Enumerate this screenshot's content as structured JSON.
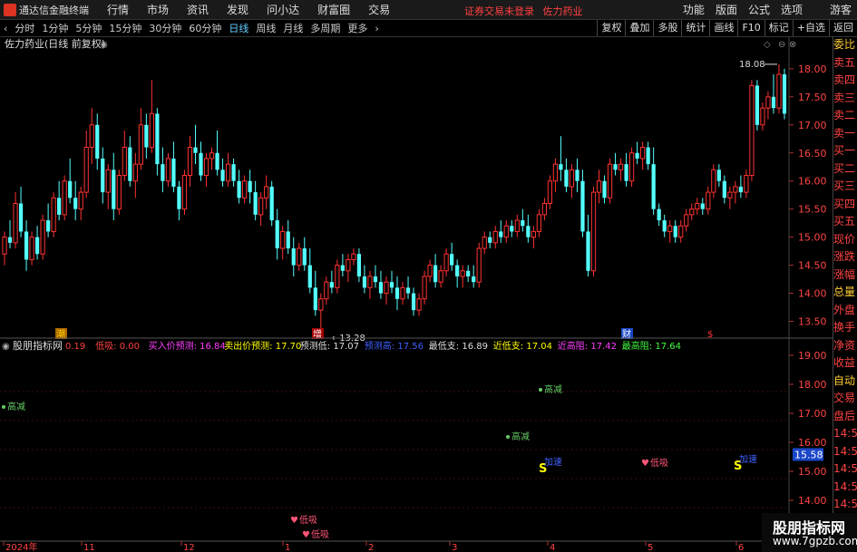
{
  "app": {
    "title": "通达信金融终端"
  },
  "menu": [
    "行情",
    "市场",
    "资讯",
    "发现",
    "问小达",
    "财富圈",
    "交易"
  ],
  "login_warning": "证券交易未登录",
  "stock_name": "佐力药业",
  "menu_right": [
    "功能",
    "版面",
    "公式",
    "选项",
    "游客"
  ],
  "periods": [
    "分时",
    "1分钟",
    "5分钟",
    "15分钟",
    "30分钟",
    "60分钟",
    "日线",
    "周线",
    "月线",
    "多周期",
    "更多"
  ],
  "active_period": "日线",
  "toolbar_right": [
    "复权",
    "叠加",
    "多股",
    "统计",
    "画线",
    "F10",
    "标记",
    "+自选",
    "返回"
  ],
  "chart_title": "佐力药业(日线 前复权)",
  "side_panel": [
    {
      "t": "委比",
      "c": "yellow"
    },
    {
      "t": "卖五",
      "c": "red"
    },
    {
      "t": "卖四",
      "c": "red"
    },
    {
      "t": "卖三",
      "c": "red"
    },
    {
      "t": "卖二",
      "c": "red"
    },
    {
      "t": "卖一",
      "c": "red"
    },
    {
      "t": "买一",
      "c": "red"
    },
    {
      "t": "买二",
      "c": "red"
    },
    {
      "t": "买三",
      "c": "red"
    },
    {
      "t": "买四",
      "c": "red"
    },
    {
      "t": "买五",
      "c": "red"
    },
    {
      "t": "现价",
      "c": "red"
    },
    {
      "t": "涨跌",
      "c": "red"
    },
    {
      "t": "涨幅",
      "c": "red"
    },
    {
      "t": "总量",
      "c": "yellow"
    },
    {
      "t": "外盘",
      "c": "red"
    },
    {
      "t": "换手",
      "c": "red"
    },
    {
      "t": "净资",
      "c": "red"
    },
    {
      "t": "收益",
      "c": "red"
    },
    {
      "t": "自动",
      "c": "yellow"
    },
    {
      "t": "交易",
      "c": "red"
    },
    {
      "t": "盘后",
      "c": "red"
    },
    {
      "t": "14:56",
      "c": "red"
    },
    {
      "t": "14:56",
      "c": "red"
    },
    {
      "t": "14:56",
      "c": "red"
    },
    {
      "t": "14:56",
      "c": "red"
    },
    {
      "t": "14:56",
      "c": "red"
    },
    {
      "t": "14:56",
      "c": "red"
    },
    {
      "t": "14:56",
      "c": "red"
    }
  ],
  "price_axis": {
    "ticks": [
      18.0,
      17.5,
      17.0,
      16.5,
      16.0,
      15.5,
      15.0,
      14.5,
      14.0,
      13.5
    ],
    "top": 18.45,
    "bottom": 13.25
  },
  "main_annotations": {
    "high": "18.08",
    "low": "13.28",
    "markers": [
      "潮",
      "增",
      "财",
      "$"
    ]
  },
  "indicator": {
    "name": "股朋指标网",
    "values": [
      {
        "label": "",
        "value": "0.19",
        "color": "#ff4040"
      },
      {
        "label": "低吸:",
        "value": "0.00",
        "color": "#ff4040"
      },
      {
        "label": "买入价预测:",
        "value": "16.84",
        "color": "#ff40ff"
      },
      {
        "label": "卖出价预测:",
        "value": "17.70",
        "color": "#ffff00"
      },
      {
        "label": "预测低:",
        "value": "17.07",
        "color": "#dddddd"
      },
      {
        "label": "预测高:",
        "value": "17.56",
        "color": "#4060ff"
      },
      {
        "label": "最低支:",
        "value": "16.89",
        "color": "#dddddd"
      },
      {
        "label": "近低支:",
        "value": "17.04",
        "color": "#ffff00"
      },
      {
        "label": "近高阻:",
        "value": "17.42",
        "color": "#ff40ff"
      },
      {
        "label": "最高阻:",
        "value": "17.64",
        "color": "#40ff40"
      }
    ],
    "axis_ticks": [
      19.0,
      18.0,
      17.0,
      16.0,
      15.0,
      14.0
    ],
    "current_price": "15.58",
    "annotations": {
      "reduce": "高减",
      "accelerate": "加速",
      "buy_low": "低吸",
      "sell": "S"
    }
  },
  "date_axis": [
    "2024年",
    "11",
    "12",
    "1",
    "2",
    "3",
    "4",
    "5",
    "6"
  ],
  "watermark": {
    "line1": "股朋指标网",
    "line2": "www.7gpzb.com"
  },
  "chart_data": {
    "type": "candlestick",
    "ylim": [
      13.25,
      18.45
    ],
    "candles": [
      [
        14.7,
        15.1,
        14.5,
        15.0
      ],
      [
        15.0,
        15.3,
        14.8,
        14.9
      ],
      [
        14.9,
        15.8,
        14.8,
        15.6
      ],
      [
        15.6,
        15.9,
        15.0,
        15.1
      ],
      [
        15.1,
        15.3,
        14.4,
        14.6
      ],
      [
        14.6,
        15.1,
        14.5,
        15.0
      ],
      [
        15.0,
        15.2,
        14.6,
        14.7
      ],
      [
        14.7,
        15.4,
        14.6,
        15.3
      ],
      [
        15.3,
        15.6,
        15.0,
        15.1
      ],
      [
        15.1,
        15.8,
        15.0,
        15.7
      ],
      [
        15.7,
        16.0,
        15.3,
        15.4
      ],
      [
        15.4,
        16.1,
        15.3,
        16.0
      ],
      [
        16.0,
        16.4,
        15.6,
        15.7
      ],
      [
        15.7,
        16.0,
        15.3,
        15.5
      ],
      [
        15.5,
        15.9,
        15.3,
        15.8
      ],
      [
        15.8,
        16.9,
        15.7,
        16.6
      ],
      [
        16.6,
        17.3,
        16.3,
        17.0
      ],
      [
        17.0,
        17.2,
        16.2,
        16.4
      ],
      [
        16.4,
        16.6,
        15.6,
        15.8
      ],
      [
        15.8,
        16.3,
        15.5,
        16.2
      ],
      [
        16.2,
        16.5,
        15.3,
        15.5
      ],
      [
        15.5,
        16.2,
        15.4,
        16.1
      ],
      [
        16.1,
        16.9,
        16.0,
        16.6
      ],
      [
        16.6,
        16.8,
        15.9,
        16.0
      ],
      [
        16.0,
        16.5,
        15.7,
        16.3
      ],
      [
        16.3,
        17.3,
        16.2,
        17.0
      ],
      [
        17.0,
        17.2,
        16.4,
        16.6
      ],
      [
        16.6,
        17.8,
        16.5,
        17.2
      ],
      [
        17.2,
        17.3,
        16.1,
        16.3
      ],
      [
        16.3,
        16.6,
        15.8,
        16.0
      ],
      [
        16.0,
        16.5,
        15.9,
        16.4
      ],
      [
        16.4,
        16.7,
        15.8,
        15.9
      ],
      [
        15.9,
        16.0,
        15.3,
        15.5
      ],
      [
        15.5,
        16.2,
        15.4,
        16.1
      ],
      [
        16.1,
        16.8,
        15.9,
        16.6
      ],
      [
        16.6,
        17.0,
        16.3,
        16.5
      ],
      [
        16.5,
        16.7,
        16.0,
        16.1
      ],
      [
        16.1,
        16.5,
        15.9,
        16.4
      ],
      [
        16.4,
        16.6,
        16.2,
        16.5
      ],
      [
        16.5,
        16.9,
        16.1,
        16.2
      ],
      [
        16.2,
        16.4,
        15.9,
        16.0
      ],
      [
        16.0,
        16.5,
        15.9,
        16.3
      ],
      [
        16.3,
        16.4,
        15.9,
        16.0
      ],
      [
        16.0,
        16.2,
        15.6,
        15.7
      ],
      [
        15.7,
        16.1,
        15.6,
        16.0
      ],
      [
        16.0,
        16.2,
        15.6,
        15.8
      ],
      [
        15.8,
        16.0,
        15.3,
        15.4
      ],
      [
        15.4,
        15.8,
        15.2,
        15.7
      ],
      [
        15.7,
        16.1,
        15.5,
        15.9
      ],
      [
        15.9,
        16.0,
        15.2,
        15.3
      ],
      [
        15.3,
        15.5,
        14.6,
        14.8
      ],
      [
        14.8,
        15.2,
        14.6,
        15.1
      ],
      [
        15.1,
        15.3,
        14.7,
        14.8
      ],
      [
        14.8,
        15.0,
        14.3,
        14.5
      ],
      [
        14.5,
        14.9,
        14.4,
        14.8
      ],
      [
        14.8,
        15.0,
        14.4,
        14.5
      ],
      [
        14.5,
        14.8,
        14.0,
        14.1
      ],
      [
        14.1,
        14.4,
        13.6,
        13.7
      ],
      [
        13.7,
        14.0,
        13.28,
        13.9
      ],
      [
        13.9,
        14.3,
        13.8,
        14.2
      ],
      [
        14.2,
        14.4,
        14.0,
        14.1
      ],
      [
        14.1,
        14.6,
        14.0,
        14.5
      ],
      [
        14.5,
        14.7,
        14.3,
        14.4
      ],
      [
        14.4,
        14.7,
        14.2,
        14.6
      ],
      [
        14.6,
        14.8,
        14.5,
        14.7
      ],
      [
        14.7,
        14.8,
        14.2,
        14.3
      ],
      [
        14.3,
        14.5,
        14.0,
        14.1
      ],
      [
        14.1,
        14.4,
        13.9,
        14.3
      ],
      [
        14.3,
        14.5,
        14.1,
        14.2
      ],
      [
        14.2,
        14.4,
        13.9,
        14.0
      ],
      [
        14.0,
        14.3,
        13.8,
        14.2
      ],
      [
        14.2,
        14.4,
        14.0,
        14.1
      ],
      [
        14.1,
        14.3,
        13.7,
        13.9
      ],
      [
        13.9,
        14.2,
        13.8,
        14.1
      ],
      [
        14.1,
        14.3,
        13.9,
        14.0
      ],
      [
        14.0,
        14.1,
        13.6,
        13.7
      ],
      [
        13.7,
        14.0,
        13.6,
        13.9
      ],
      [
        13.9,
        14.4,
        13.8,
        14.3
      ],
      [
        14.3,
        14.6,
        14.2,
        14.5
      ],
      [
        14.5,
        14.7,
        14.1,
        14.2
      ],
      [
        14.2,
        14.5,
        14.1,
        14.4
      ],
      [
        14.4,
        14.8,
        14.3,
        14.7
      ],
      [
        14.7,
        14.9,
        14.4,
        14.5
      ],
      [
        14.5,
        14.6,
        14.1,
        14.3
      ],
      [
        14.3,
        14.5,
        14.1,
        14.4
      ],
      [
        14.4,
        14.5,
        14.2,
        14.3
      ],
      [
        14.3,
        14.5,
        14.1,
        14.2
      ],
      [
        14.2,
        14.9,
        14.1,
        14.8
      ],
      [
        14.8,
        15.1,
        14.7,
        15.0
      ],
      [
        15.0,
        15.1,
        14.8,
        14.9
      ],
      [
        14.9,
        15.2,
        14.8,
        15.1
      ],
      [
        15.1,
        15.3,
        14.9,
        15.0
      ],
      [
        15.0,
        15.3,
        14.9,
        15.2
      ],
      [
        15.2,
        15.3,
        15.0,
        15.1
      ],
      [
        15.1,
        15.4,
        15.0,
        15.3
      ],
      [
        15.3,
        15.5,
        15.1,
        15.2
      ],
      [
        15.2,
        15.4,
        14.9,
        15.0
      ],
      [
        15.0,
        15.2,
        14.8,
        15.1
      ],
      [
        15.1,
        15.5,
        15.0,
        15.4
      ],
      [
        15.4,
        15.7,
        15.3,
        15.6
      ],
      [
        15.6,
        16.1,
        15.5,
        16.0
      ],
      [
        16.0,
        16.4,
        15.8,
        16.3
      ],
      [
        16.3,
        16.8,
        16.0,
        16.2
      ],
      [
        16.2,
        16.4,
        15.8,
        15.9
      ],
      [
        15.9,
        16.3,
        15.7,
        16.2
      ],
      [
        16.2,
        16.4,
        15.8,
        16.0
      ],
      [
        16.0,
        16.2,
        15.0,
        15.1
      ],
      [
        15.1,
        15.4,
        14.3,
        14.4
      ],
      [
        14.4,
        15.9,
        14.3,
        15.8
      ],
      [
        15.8,
        16.2,
        15.6,
        16.0
      ],
      [
        16.0,
        16.1,
        15.6,
        15.7
      ],
      [
        15.7,
        16.4,
        15.6,
        16.3
      ],
      [
        16.3,
        16.5,
        16.1,
        16.2
      ],
      [
        16.2,
        16.4,
        16.0,
        16.3
      ],
      [
        16.3,
        16.5,
        15.9,
        16.0
      ],
      [
        16.0,
        16.6,
        15.9,
        16.5
      ],
      [
        16.5,
        16.7,
        16.3,
        16.4
      ],
      [
        16.4,
        16.7,
        16.2,
        16.6
      ],
      [
        16.6,
        16.7,
        16.2,
        16.3
      ],
      [
        16.3,
        16.6,
        15.4,
        15.5
      ],
      [
        15.5,
        15.6,
        15.2,
        15.3
      ],
      [
        15.3,
        15.4,
        15.0,
        15.1
      ],
      [
        15.1,
        15.3,
        14.9,
        15.2
      ],
      [
        15.2,
        15.3,
        14.9,
        15.0
      ],
      [
        15.0,
        15.3,
        14.9,
        15.2
      ],
      [
        15.2,
        15.5,
        15.1,
        15.4
      ],
      [
        15.4,
        15.6,
        15.3,
        15.5
      ],
      [
        15.5,
        15.7,
        15.4,
        15.6
      ],
      [
        15.6,
        15.7,
        15.4,
        15.5
      ],
      [
        15.5,
        15.9,
        15.4,
        15.8
      ],
      [
        15.8,
        16.3,
        15.7,
        16.2
      ],
      [
        16.2,
        16.3,
        15.9,
        16.0
      ],
      [
        16.0,
        16.1,
        15.6,
        15.7
      ],
      [
        15.7,
        15.9,
        15.5,
        15.8
      ],
      [
        15.8,
        16.0,
        15.6,
        15.9
      ],
      [
        15.9,
        16.1,
        15.7,
        15.8
      ],
      [
        15.8,
        16.2,
        15.7,
        16.1
      ],
      [
        16.1,
        17.8,
        16.0,
        17.7
      ],
      [
        17.7,
        17.8,
        16.9,
        17.0
      ],
      [
        17.0,
        17.4,
        16.9,
        17.3
      ],
      [
        17.3,
        17.6,
        17.1,
        17.5
      ],
      [
        17.5,
        17.9,
        17.2,
        17.3
      ],
      [
        17.3,
        18.08,
        17.2,
        17.9
      ],
      [
        17.9,
        18.0,
        17.1,
        17.2
      ]
    ]
  }
}
